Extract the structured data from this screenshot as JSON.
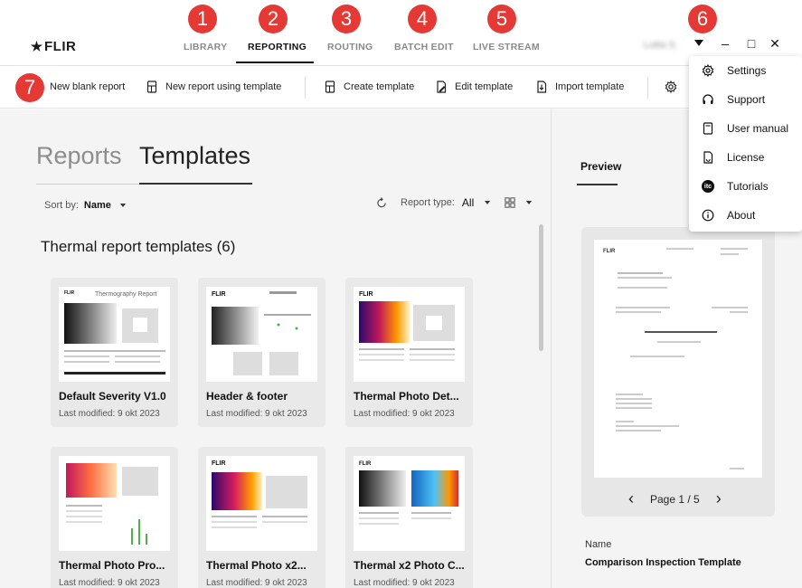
{
  "app": {
    "logo": "FLIR",
    "user_name": "Lotta S.",
    "window_controls": {
      "minimize": "–",
      "maximize": "□",
      "close": "✕"
    }
  },
  "nav": {
    "tabs": [
      {
        "label": "LIBRARY",
        "active": false
      },
      {
        "label": "REPORTING",
        "active": true
      },
      {
        "label": "ROUTING",
        "active": false
      },
      {
        "label": "BATCH EDIT",
        "active": false
      },
      {
        "label": "LIVE STREAM",
        "active": false
      }
    ]
  },
  "callouts": [
    "1",
    "2",
    "3",
    "4",
    "5",
    "6",
    "7"
  ],
  "toolbar": {
    "new_blank": "New blank report",
    "new_using_template": "New report using template",
    "create_template": "Create template",
    "edit_template": "Edit template",
    "import_template": "Import template"
  },
  "segments": {
    "reports": "Reports",
    "templates": "Templates"
  },
  "sort": {
    "label": "Sort by:",
    "value": "Name"
  },
  "filter": {
    "label": "Report type:",
    "value": "All"
  },
  "section": {
    "title": "Thermal report templates (6)"
  },
  "templates": [
    {
      "title": "Default Severity V1.0",
      "modified": "Last modified: 9 okt 2023",
      "thumb_heading": "Thermography Report"
    },
    {
      "title": "Header & footer",
      "modified": "Last modified: 9 okt 2023"
    },
    {
      "title": "Thermal Photo Det...",
      "modified": "Last modified: 9 okt 2023"
    },
    {
      "title": "Thermal Photo Pro...",
      "modified": "Last modified: 9 okt 2023"
    },
    {
      "title": "Thermal Photo x2...",
      "modified": "Last modified: 9 okt 2023"
    },
    {
      "title": "Thermal x2 Photo C...",
      "modified": "Last modified: 9 okt 2023"
    }
  ],
  "preview": {
    "tab": "Preview",
    "page_indicator": "Page 1 / 5",
    "name_label": "Name",
    "name_value": "Comparison Inspection Template"
  },
  "menu": {
    "items": [
      {
        "label": "Settings",
        "icon": "gear-icon"
      },
      {
        "label": "Support",
        "icon": "headset-icon"
      },
      {
        "label": "User manual",
        "icon": "book-icon"
      },
      {
        "label": "License",
        "icon": "license-icon"
      },
      {
        "label": "Tutorials",
        "icon": "itc-icon",
        "badge": "itc"
      },
      {
        "label": "About",
        "icon": "info-icon"
      }
    ]
  },
  "colors": {
    "accent": "#111111",
    "callout": "#e53935",
    "card_bg": "#e9e9e9",
    "main_bg": "#f4f4f4"
  }
}
